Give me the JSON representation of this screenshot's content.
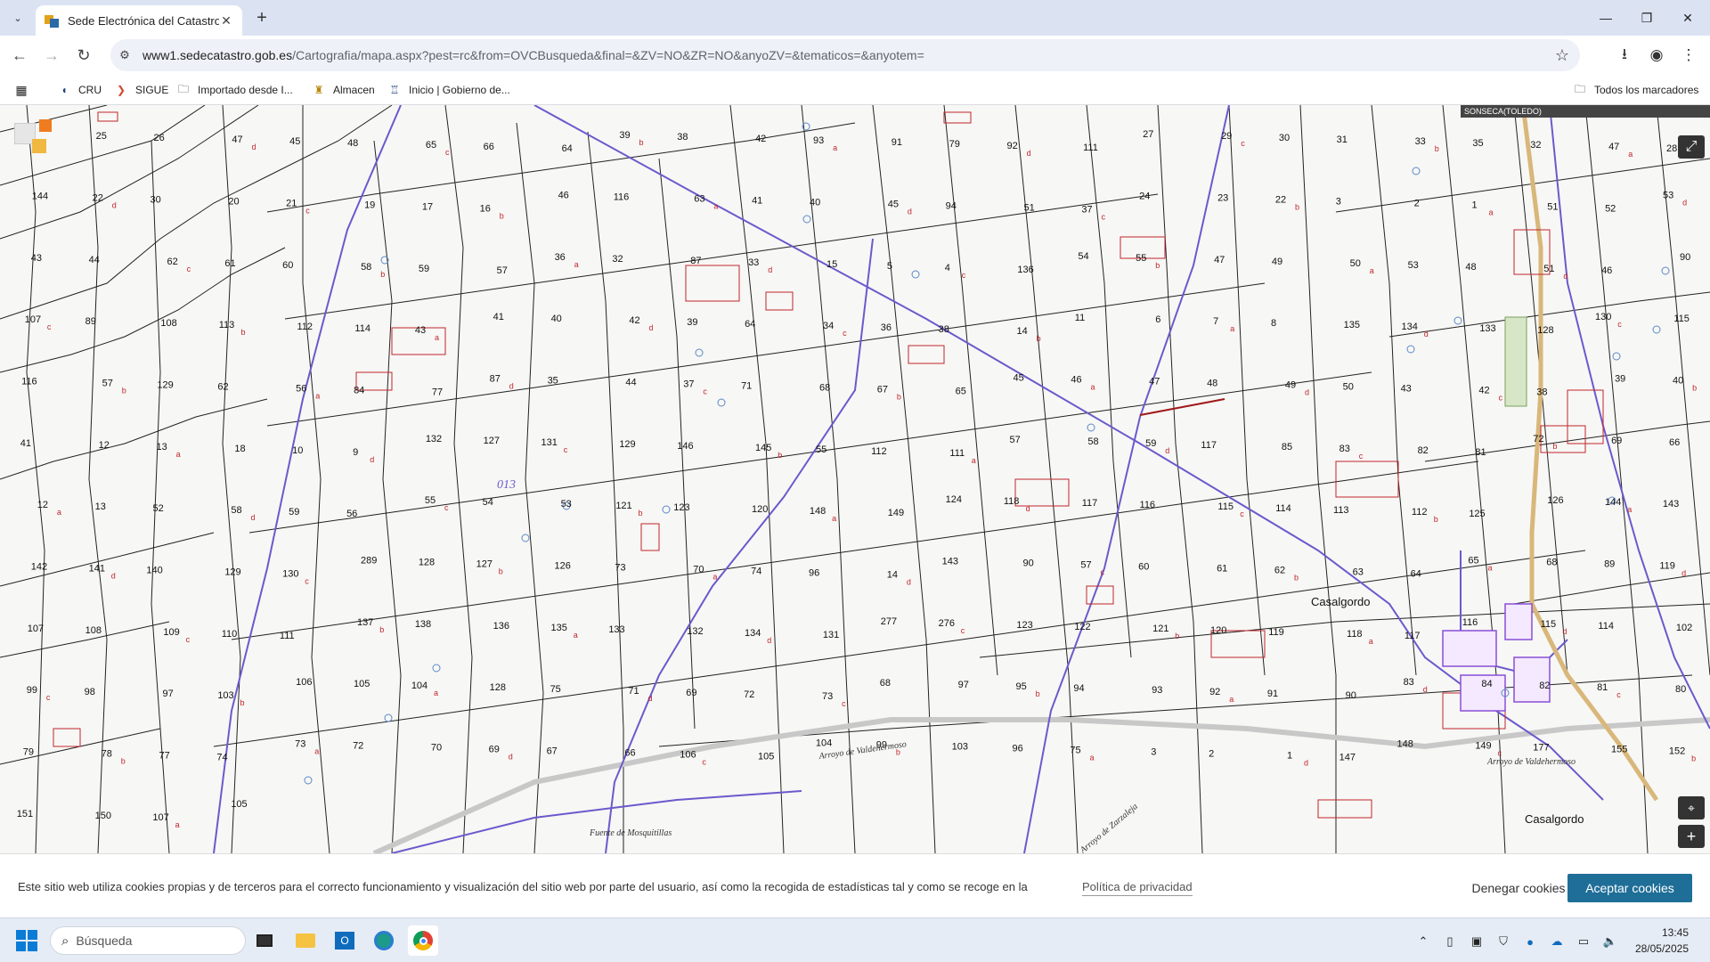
{
  "browser": {
    "tab": {
      "title": "Sede Electrónica del Catastro -",
      "close": "✕"
    },
    "new_tab": "+",
    "window_controls": {
      "minimize": "—",
      "restore": "❐",
      "close": "✕"
    },
    "url": {
      "domain": "www1.sedecatastro.gob.es",
      "path": "/Cartografia/mapa.aspx?pest=rc&from=OVCBusqueda&final=&ZV=NO&ZR=NO&anyoZV=&tematicos=&anyotem="
    },
    "bookmarks": [
      {
        "label": "",
        "icon": "apps-grid-icon"
      },
      {
        "label": "CRU",
        "icon": "cru-icon"
      },
      {
        "label": "SIGUE",
        "icon": "sigue-icon"
      },
      {
        "label": "Importado desde I...",
        "icon": "folder-icon"
      },
      {
        "label": "Almacen",
        "icon": "almacen-icon"
      },
      {
        "label": "Inicio | Gobierno de...",
        "icon": "gobierno-icon"
      }
    ],
    "all_bookmarks": "Todos los marcadores"
  },
  "map": {
    "municipality_label": "SONSECA(TOLEDO)",
    "place_names": [
      "Casalgordo",
      "Casalgordo"
    ],
    "stream_names": [
      "Arroyo de Valdehermoso",
      "Arroyo de Zarzaleja",
      "Fuente de Mosquitillas",
      "Arroyo de Valdehermoso"
    ],
    "polygon_code": "013",
    "parcel_numbers": [
      "24",
      "25",
      "26",
      "47",
      "45",
      "48",
      "65",
      "66",
      "64",
      "39",
      "38",
      "42",
      "93",
      "91",
      "79",
      "92",
      "111",
      "27",
      "29",
      "30",
      "31",
      "33",
      "35",
      "32",
      "47",
      "28",
      "144",
      "22",
      "30",
      "20",
      "21",
      "19",
      "17",
      "16",
      "46",
      "116",
      "63",
      "41",
      "40",
      "45",
      "94",
      "51",
      "37",
      "24",
      "23",
      "22",
      "3",
      "2",
      "1",
      "51",
      "52",
      "53",
      "43",
      "44",
      "62",
      "61",
      "60",
      "58",
      "59",
      "57",
      "36",
      "32",
      "87",
      "33",
      "15",
      "5",
      "4",
      "136",
      "54",
      "55",
      "47",
      "49",
      "50",
      "53",
      "48",
      "51",
      "46",
      "90",
      "107",
      "89",
      "108",
      "113",
      "112",
      "114",
      "43",
      "41",
      "40",
      "42",
      "39",
      "64",
      "34",
      "36",
      "38",
      "14",
      "11",
      "6",
      "7",
      "8",
      "135",
      "134",
      "133",
      "128",
      "130",
      "115",
      "116",
      "57",
      "129",
      "62",
      "56",
      "84",
      "77",
      "87",
      "35",
      "44",
      "37",
      "71",
      "68",
      "67",
      "65",
      "45",
      "46",
      "47",
      "48",
      "49",
      "50",
      "43",
      "42",
      "38",
      "39",
      "40",
      "41",
      "12",
      "13",
      "18",
      "10",
      "9",
      "132",
      "127",
      "131",
      "129",
      "146",
      "145",
      "55",
      "112",
      "111",
      "57",
      "58",
      "59",
      "117",
      "85",
      "83",
      "82",
      "81",
      "72",
      "69",
      "66",
      "12",
      "13",
      "52",
      "58",
      "59",
      "56",
      "55",
      "54",
      "53",
      "121",
      "123",
      "120",
      "148",
      "149",
      "124",
      "118",
      "117",
      "116",
      "115",
      "114",
      "113",
      "112",
      "125",
      "126",
      "144",
      "143",
      "142",
      "141",
      "140",
      "129",
      "130",
      "289",
      "128",
      "127",
      "126",
      "73",
      "70",
      "74",
      "96",
      "14",
      "143",
      "90",
      "57",
      "60",
      "61",
      "62",
      "63",
      "64",
      "65",
      "68",
      "89",
      "119",
      "107",
      "108",
      "109",
      "110",
      "111",
      "137",
      "138",
      "136",
      "135",
      "133",
      "132",
      "134",
      "131",
      "277",
      "276",
      "123",
      "122",
      "121",
      "120",
      "119",
      "118",
      "117",
      "116",
      "115",
      "114",
      "102",
      "99",
      "98",
      "97",
      "103",
      "106",
      "105",
      "104",
      "128",
      "75",
      "71",
      "69",
      "72",
      "73",
      "68",
      "97",
      "95",
      "94",
      "93",
      "92",
      "91",
      "90",
      "83",
      "84",
      "82",
      "81",
      "80",
      "79",
      "78",
      "77",
      "74",
      "73",
      "72",
      "70",
      "69",
      "67",
      "66",
      "106",
      "105",
      "104",
      "99",
      "103",
      "96",
      "75",
      "3",
      "2",
      "1",
      "147",
      "148",
      "149",
      "177",
      "155",
      "152",
      "151",
      "150",
      "107",
      "105"
    ],
    "controls": {
      "fullscreen": "⤢",
      "locate": "⌖",
      "zoom_in": "+"
    }
  },
  "cookie_banner": {
    "text": "Este sitio web utiliza cookies propias y de terceros para el correcto funcionamiento y visualización del sitio web por parte del usuario, así como la recogida de estadísticas tal y como se recoge en la",
    "policy_link": "Política de privacidad",
    "deny": "Denegar cookies",
    "accept": "Aceptar cookies"
  },
  "taskbar": {
    "search_placeholder": "Búsqueda",
    "time": "13:45",
    "date": "28/05/2025",
    "apps": [
      "task-view-icon",
      "file-explorer-icon",
      "outlook-icon",
      "edge-icon",
      "chrome-icon"
    ],
    "tray": [
      "chevron-up-icon",
      "usb-icon",
      "tray-app-icon",
      "shield-icon",
      "teams-icon",
      "onedrive-icon",
      "display-icon",
      "volume-icon"
    ]
  },
  "colors": {
    "tabbar": "#dbe3f3",
    "parcel_line": "#1a1a1a",
    "building_line": "#c0262c",
    "road_line": "#6a5acd",
    "accept_button": "#1f6e98"
  }
}
